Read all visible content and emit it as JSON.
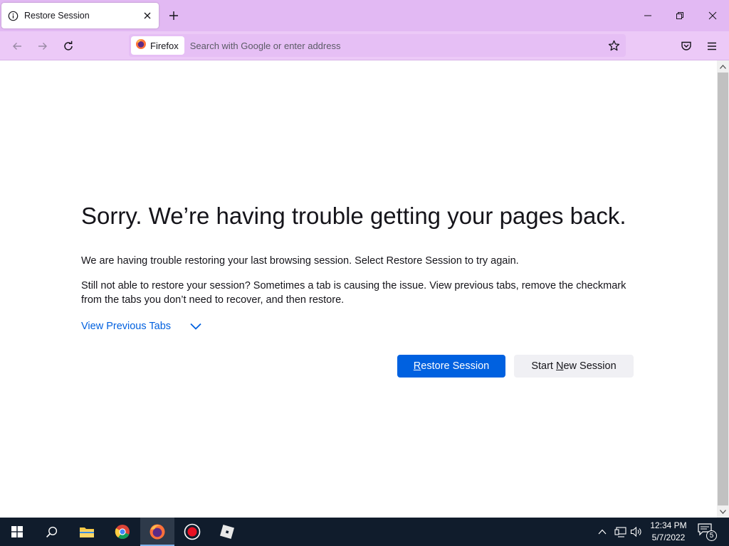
{
  "tab": {
    "title": "Restore Session"
  },
  "urlbar": {
    "identity_label": "Firefox",
    "placeholder": "Search with Google or enter address"
  },
  "content": {
    "title": "Sorry. We’re having trouble getting your pages back.",
    "para1": "We are having trouble restoring your last browsing session. Select Restore Session to try again.",
    "para2": "Still not able to restore your session? Sometimes a tab is causing the issue. View previous tabs, remove the checkmark from the tabs you don’t need to recover, and then restore.",
    "toggle_label": "View Previous Tabs",
    "restore_button": {
      "before": "",
      "accel": "R",
      "after": "estore Session"
    },
    "new_session_button": {
      "before": "Start ",
      "accel": "N",
      "after": "ew Session"
    }
  },
  "taskbar": {
    "apps": [
      "start-icon",
      "search-icon",
      "file-explorer-icon",
      "chrome-icon",
      "firefox-icon",
      "record-icon",
      "roblox-icon"
    ],
    "active_app": "firefox-icon",
    "time": "12:34 PM",
    "date": "5/7/2022",
    "notification_count": "5"
  },
  "colors": {
    "tabstrip": "#e2b9f3",
    "navbar": "#ecc9f7",
    "accent": "#0061e0",
    "link": "#0060df",
    "taskbar": "#101c2c"
  }
}
